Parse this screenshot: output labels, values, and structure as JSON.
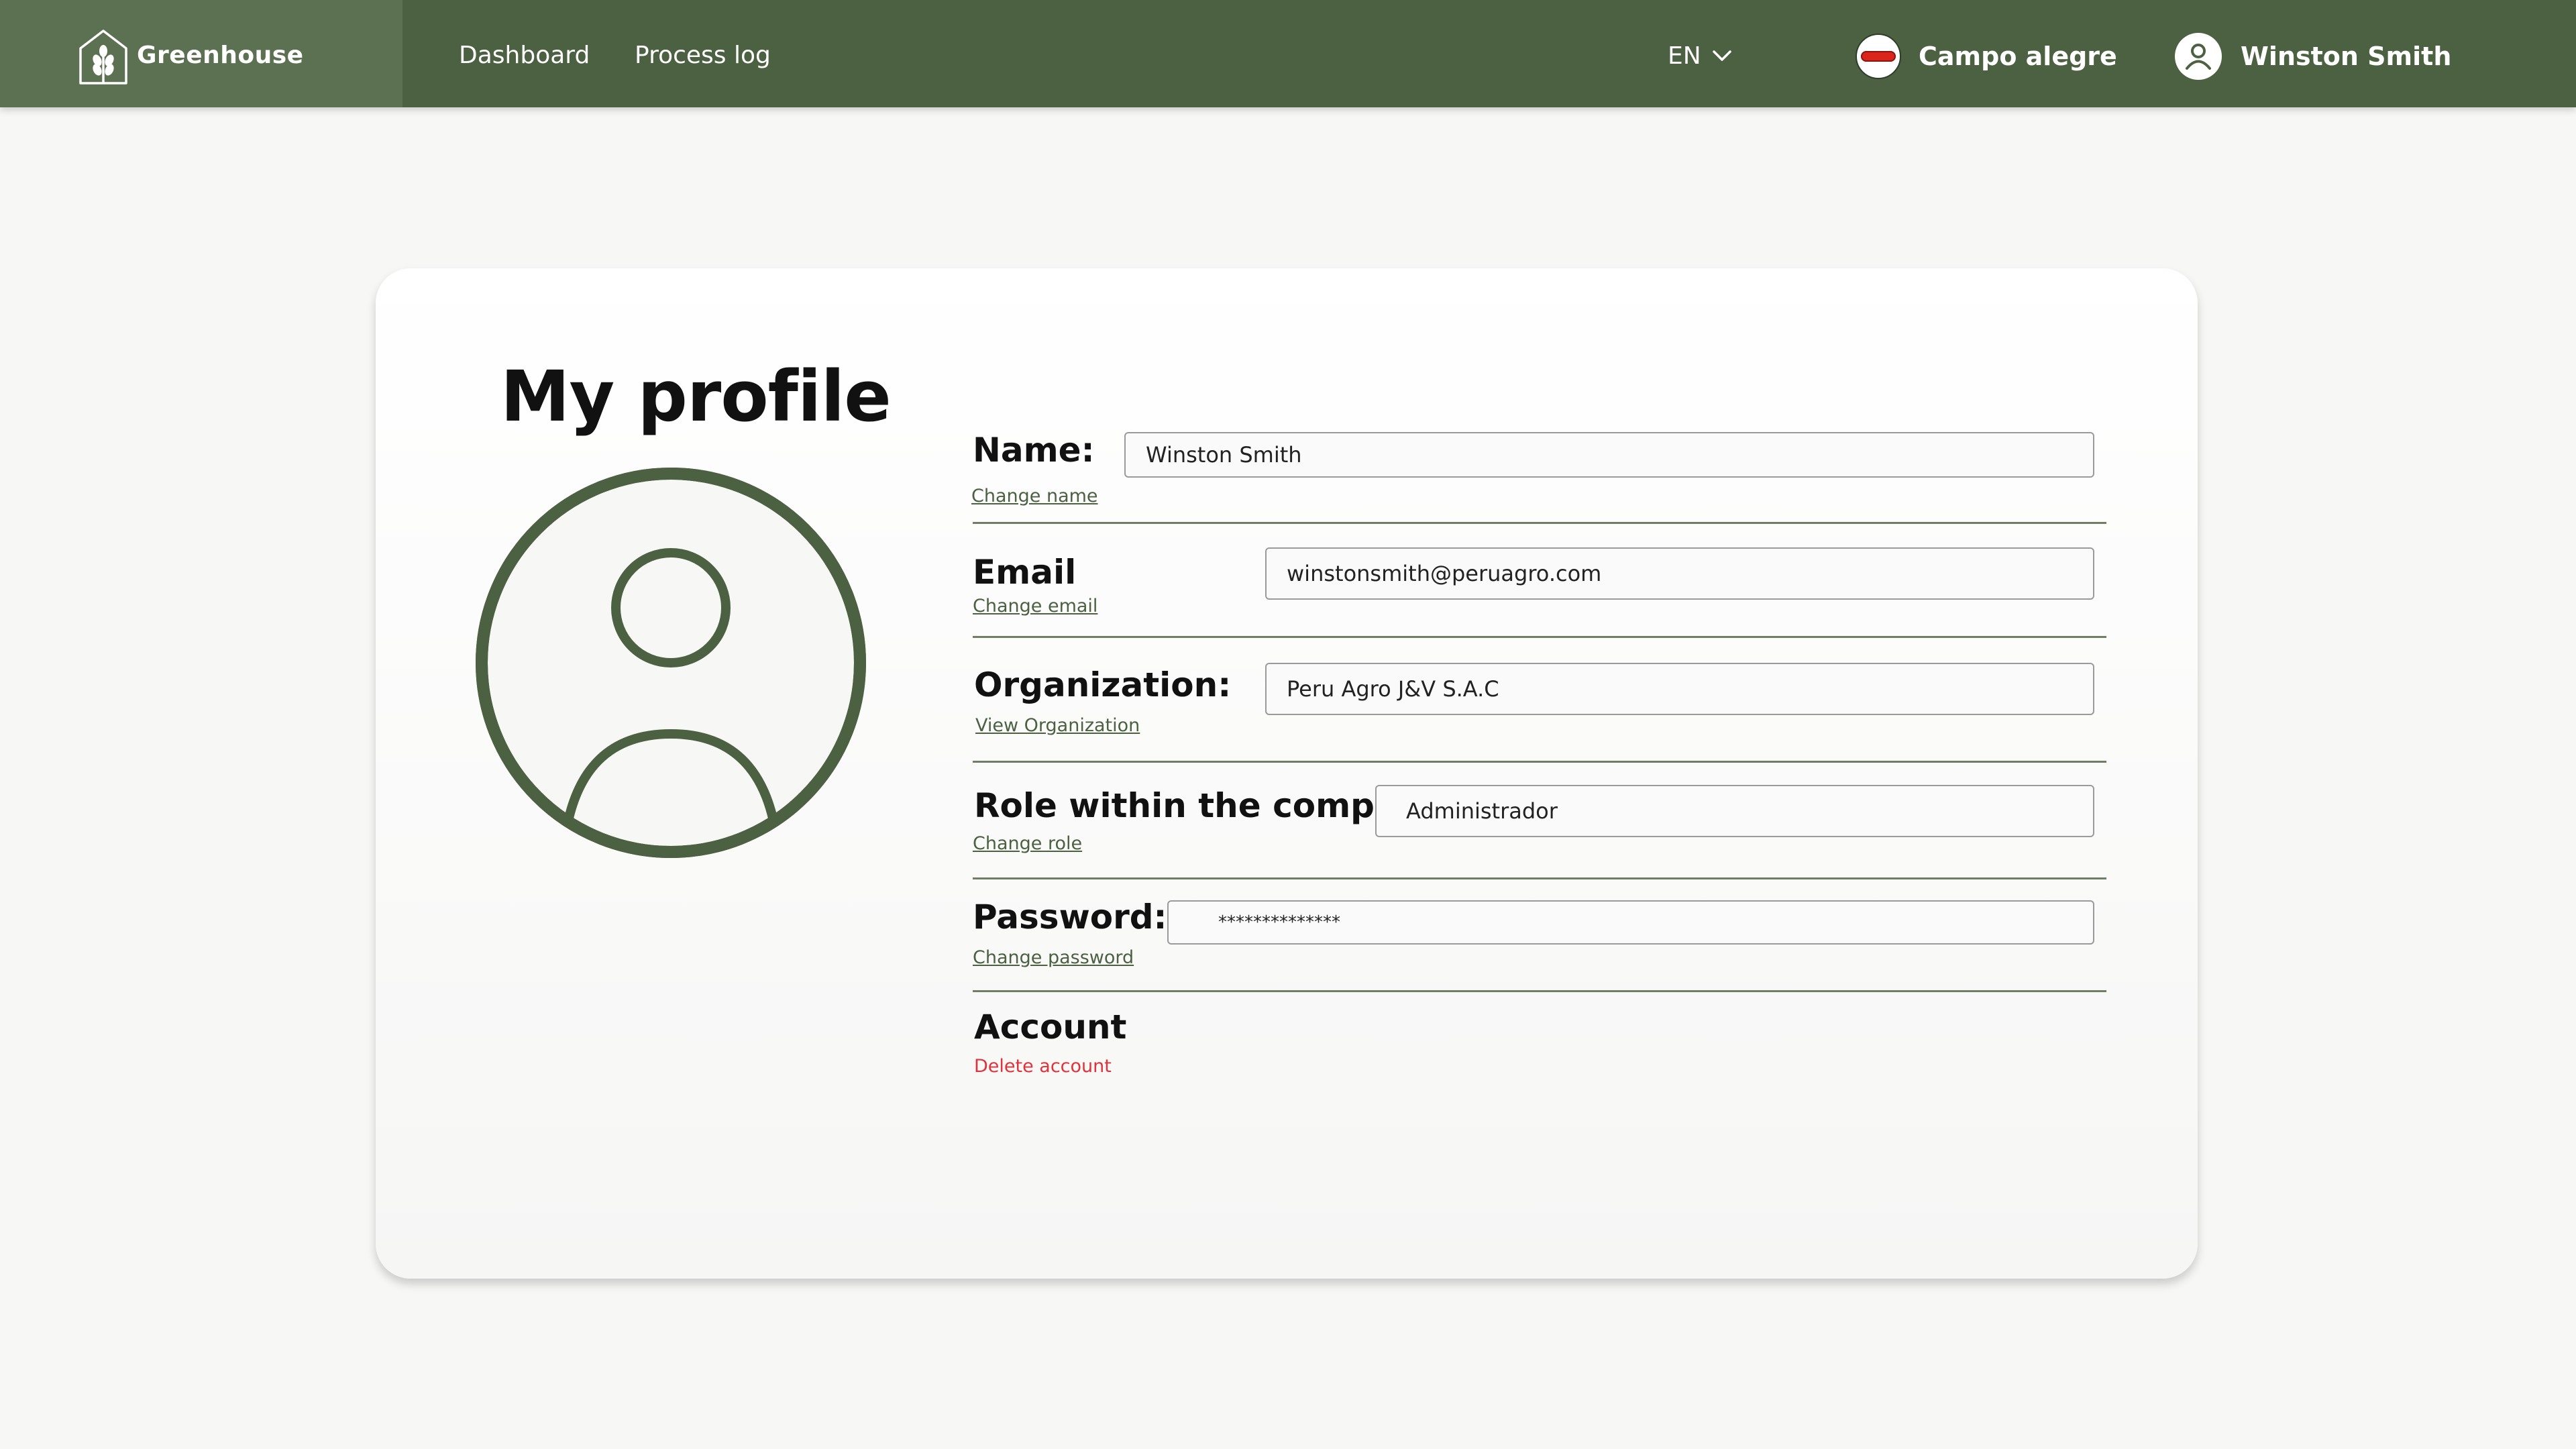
{
  "app": {
    "brand_name": "Greenhouse"
  },
  "nav": {
    "items": [
      {
        "label": "Dashboard"
      },
      {
        "label": "Process log"
      }
    ]
  },
  "language": {
    "selected": "EN"
  },
  "organization_switch": {
    "label": "Campo alegre"
  },
  "user_menu": {
    "name": "Winston Smith"
  },
  "profile": {
    "title": "My profile",
    "fields": {
      "name": {
        "label": "Name:",
        "value": "Winston Smith",
        "link": "Change name"
      },
      "email": {
        "label": "Email",
        "value": "winstonsmith@peruagro.com",
        "link": "Change email"
      },
      "organization": {
        "label": "Organization:",
        "value": "Peru Agro J&V S.A.C",
        "link": "View Organization"
      },
      "role": {
        "label": "Role within the company:",
        "value": "Administrador",
        "link": "Change role"
      },
      "password": {
        "label": "Password:",
        "value": "**************",
        "link": "Change password"
      }
    },
    "account": {
      "label": "Account",
      "delete_link": "Delete account"
    }
  },
  "colors": {
    "primary": "#4b6141",
    "primary_light": "#5b7151",
    "danger": "#e0323a",
    "background": "#f7f7f6"
  }
}
